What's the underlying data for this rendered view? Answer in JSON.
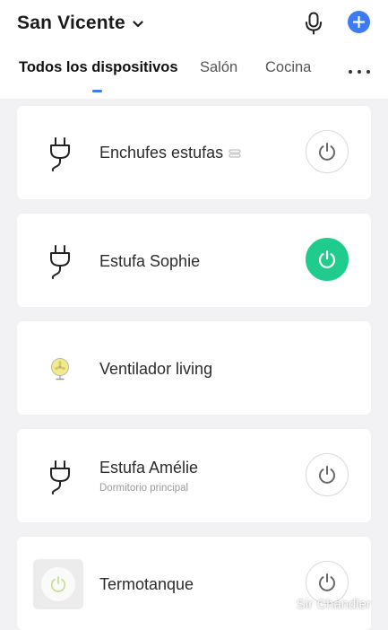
{
  "header": {
    "home_name": "San Vicente",
    "accent_color": "#3d7bf5"
  },
  "tabs": [
    {
      "label": "Todos los dispositivos",
      "active": true
    },
    {
      "label": "Salón",
      "active": false
    },
    {
      "label": "Cocina",
      "active": false
    }
  ],
  "devices": [
    {
      "name": "Enchufes estufas",
      "icon": "plug-icon",
      "is_group": true,
      "power": "off"
    },
    {
      "name": "Estufa Sophie",
      "icon": "plug-icon",
      "power": "on"
    },
    {
      "name": "Ventilador living",
      "icon": "fan-icon"
    },
    {
      "name": "Estufa Amélie",
      "room": "Dormitorio principal",
      "icon": "plug-icon",
      "power": "off"
    },
    {
      "name": "Termotanque",
      "icon": "water-heater-icon",
      "power": "off"
    }
  ],
  "power_on_color": "#1fcc8d",
  "watermark": "Sir Chandler"
}
